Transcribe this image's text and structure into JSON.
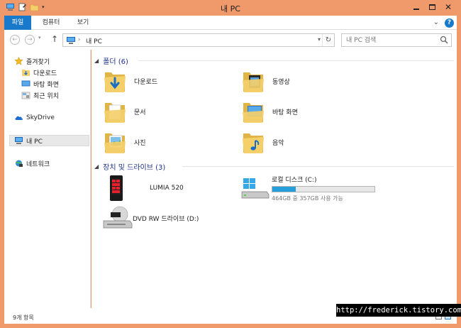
{
  "window": {
    "title": "내 PC",
    "accent": "#f09a6c",
    "close_glyph": "✕"
  },
  "ribbon": {
    "tabs": [
      "파일",
      "컴퓨터",
      "보기"
    ],
    "expand_glyph": "⌄",
    "help_glyph": "?"
  },
  "address_bar": {
    "back_glyph": "←",
    "forward_glyph": "→",
    "history_glyph": "▾",
    "up_glyph": "↑",
    "separator": "›",
    "location": "내 PC",
    "dropdown_glyph": "▾",
    "refresh_glyph": "↻",
    "search_placeholder": "내 PC 검색"
  },
  "nav_pane": {
    "favorites": {
      "label": "즐겨찾기",
      "items": [
        "다운로드",
        "바탕 화면",
        "최근 위치"
      ]
    },
    "skydrive": "SkyDrive",
    "this_pc": "내 PC",
    "network": "네트워크"
  },
  "content": {
    "folders_group": {
      "caret": "◢",
      "title": "폴더 (6)",
      "items": [
        "다운로드",
        "동영상",
        "문서",
        "바탕 화면",
        "사진",
        "음악"
      ]
    },
    "devices_group": {
      "caret": "◢",
      "title": "장치 및 드라이브 (3)",
      "phone": "LUMIA 520",
      "local_disk": {
        "name": "로컬 디스크 (C:)",
        "free_text": "464GB 중 357GB 사용 가능",
        "used_fraction": 0.23
      },
      "dvd": "DVD RW 드라이브 (D:)"
    }
  },
  "status_bar": {
    "count": "9개 항목"
  },
  "watermark": "http://frederick.tistory.com",
  "colors": {
    "accent": "#f09a6c",
    "file_tab": "#1979ca",
    "group_title": "#1e3287",
    "drive_fill": "#26a0da",
    "folder": "#f4cf6a"
  }
}
